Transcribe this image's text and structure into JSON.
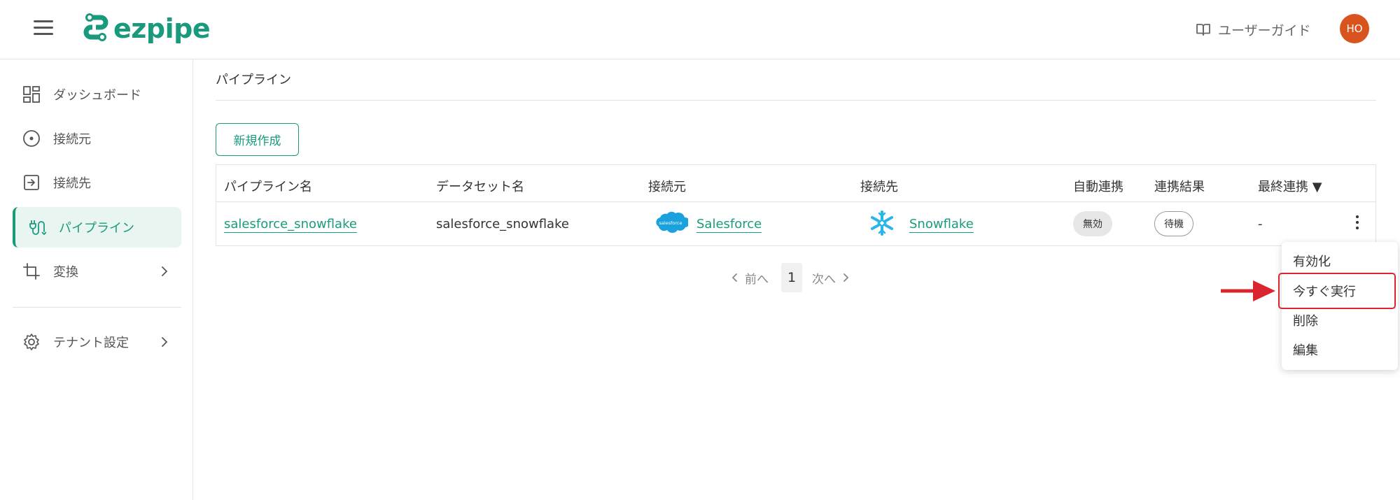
{
  "header": {
    "brand": "ezpipe",
    "guide_label": "ユーザーガイド",
    "avatar_initials": "HO",
    "brand_color": "#1a9a7c",
    "avatar_color": "#d9531e"
  },
  "sidebar": {
    "items": [
      {
        "label": "ダッシュボード",
        "icon": "dashboard-icon"
      },
      {
        "label": "接続元",
        "icon": "source-icon"
      },
      {
        "label": "接続先",
        "icon": "destination-icon"
      },
      {
        "label": "パイプライン",
        "icon": "pipeline-icon",
        "active": true
      },
      {
        "label": "変換",
        "icon": "crop-icon",
        "has_submenu": true
      },
      {
        "label": "テナント設定",
        "icon": "gear-icon",
        "has_submenu": true
      }
    ]
  },
  "main": {
    "title": "パイプライン",
    "new_button": "新規作成",
    "table": {
      "headers": [
        "パイプライン名",
        "データセット名",
        "接続元",
        "接続先",
        "自動連携",
        "連携結果",
        "最終連携 ▼"
      ],
      "rows": [
        {
          "name": "salesforce_snowflake",
          "dataset": "salesforce_snowflake",
          "source": "Salesforce",
          "source_logo_text": "salesforce",
          "destination": "Snowflake",
          "auto_sync": "無効",
          "result": "待機",
          "last_sync": "-"
        }
      ]
    },
    "pagination": {
      "prev": "前へ",
      "current": "1",
      "next": "次へ"
    }
  },
  "row_menu": {
    "items": [
      "有効化",
      "今すぐ実行",
      "削除",
      "編集"
    ],
    "highlighted_item": "今すぐ実行",
    "highlight_color": "#d9262e"
  }
}
